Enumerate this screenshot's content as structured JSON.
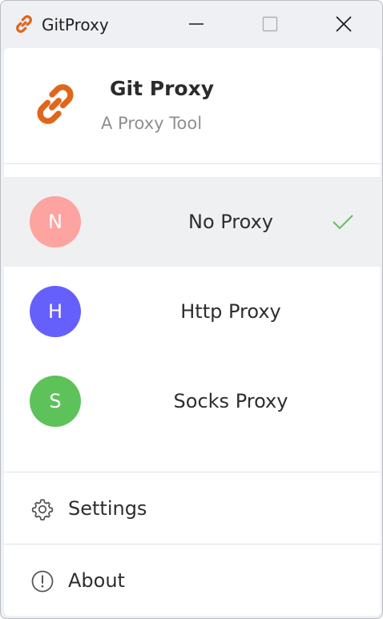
{
  "window": {
    "title": "GitProxy",
    "icon": "link-icon",
    "controls": [
      "minimize",
      "maximize",
      "close"
    ]
  },
  "header": {
    "title": "Git Proxy",
    "subtitle": "A Proxy Tool",
    "logo": "link-icon",
    "logo_color": "#e0661b"
  },
  "proxies": [
    {
      "initial": "N",
      "label": "No Proxy",
      "color": "#fda3a0",
      "selected": true
    },
    {
      "initial": "H",
      "label": "Http Proxy",
      "color": "#6560fb",
      "selected": false
    },
    {
      "initial": "S",
      "label": "Socks Proxy",
      "color": "#5ec25b",
      "selected": false
    }
  ],
  "check_color": "#64c05a",
  "menu": {
    "settings_label": "Settings",
    "settings_icon": "gear-icon",
    "about_label": "About",
    "about_icon": "info-icon"
  }
}
